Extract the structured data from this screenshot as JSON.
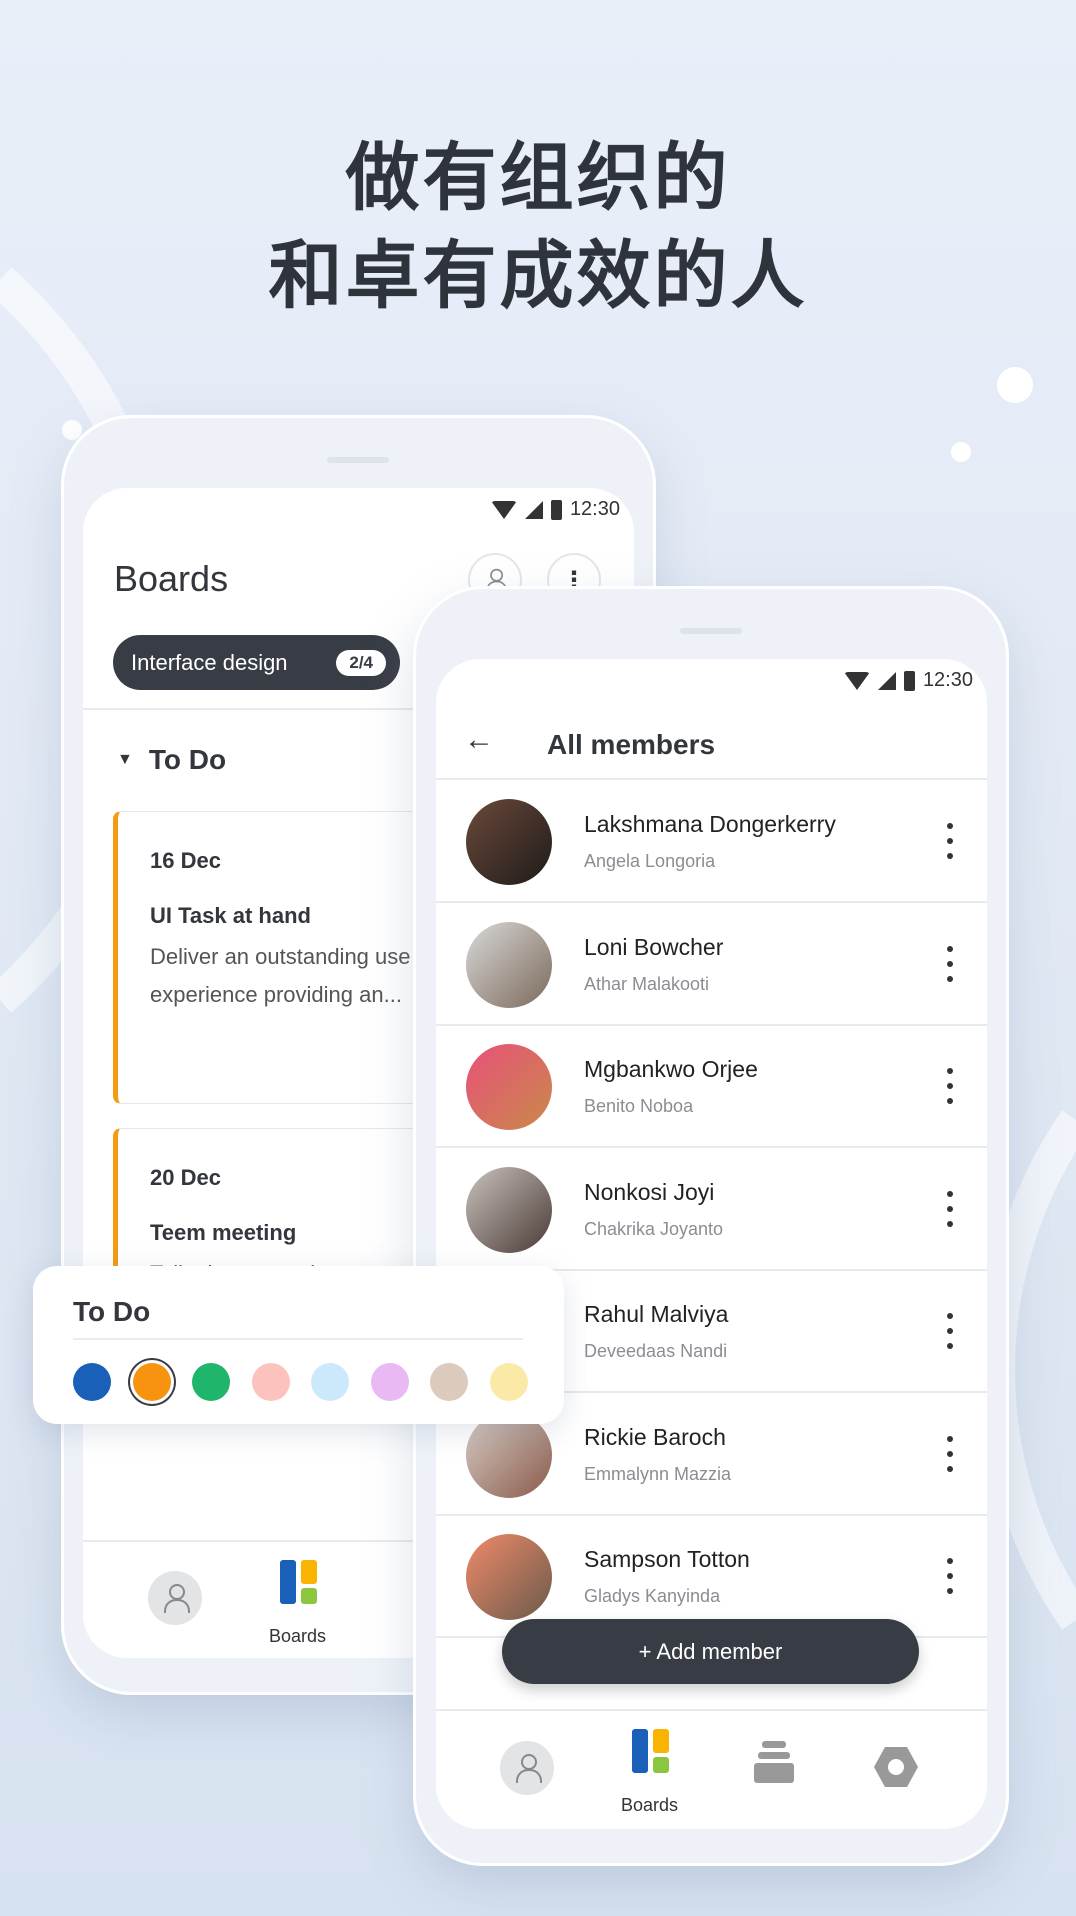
{
  "headline": {
    "line1": "做有组织的",
    "line2": "和卓有成效的人"
  },
  "status_bar": {
    "time": "12:30"
  },
  "boards_screen": {
    "title": "Boards",
    "header_icons": [
      "person-icon",
      "more-vertical-icon"
    ],
    "chip": {
      "label": "Interface design",
      "count": "2/4"
    },
    "section": "To Do",
    "cards": [
      {
        "date": "16 Dec",
        "title": "UI Task at hand",
        "description_line1": "Deliver an outstanding use",
        "description_line2": "experience providing an...",
        "accent": "#f59a11"
      },
      {
        "date": "20 Dec",
        "title": "Teem meeting",
        "description_line1": "Talk about actual",
        "accent": "#f59a11"
      }
    ],
    "nav": {
      "boards_label": "Boards"
    }
  },
  "color_popup": {
    "title": "To Do",
    "colors": [
      "#1a5fb8",
      "#f7930f",
      "#1fb56a",
      "#fcc3bd",
      "#cbe9fb",
      "#e8b9f3",
      "#dccbbd",
      "#fbeaa7"
    ],
    "selected_index": 1
  },
  "members_screen": {
    "title": "All members",
    "members": [
      {
        "name": "Lakshmana Dongerkerry",
        "subtitle": "Angela Longoria"
      },
      {
        "name": "Loni Bowcher",
        "subtitle": "Athar Malakooti"
      },
      {
        "name": "Mgbankwo Orjee",
        "subtitle": "Benito Noboa"
      },
      {
        "name": "Nonkosi Joyi",
        "subtitle": "Chakrika Joyanto"
      },
      {
        "name": "Rahul Malviya",
        "subtitle": "Deveedaas Nandi"
      },
      {
        "name": "Rickie Baroch",
        "subtitle": "Emmalynn Mazzia"
      },
      {
        "name": "Sampson Totton",
        "subtitle": "Gladys Kanyinda"
      }
    ],
    "add_button": "+ Add member",
    "nav": {
      "boards_label": "Boards"
    }
  },
  "brand_colors": {
    "blue": "#1a5fb8",
    "yellow": "#f9b300",
    "green": "#8cc63f",
    "dark": "#383c45"
  }
}
